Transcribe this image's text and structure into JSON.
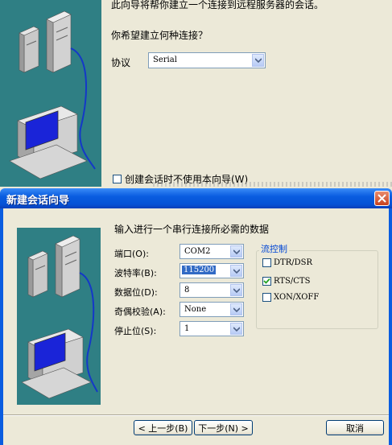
{
  "background_window": {
    "intro_text": "此向导将帮你建立一个连接到远程服务器的会话。",
    "question_text": "你希望建立何种连接？",
    "protocol_label": "协议",
    "protocol_value": "Serial",
    "no_wizard_checkbox_label": "创建会话时不使用本向导(W)",
    "no_wizard_checked": false
  },
  "dialog": {
    "title": "新建会话向导",
    "heading": "输入进行一个串行连接所必需的数据",
    "fields": {
      "port": {
        "label": "端口(O):",
        "value": "COM2"
      },
      "baud": {
        "label": "波特率(B):",
        "value": "115200"
      },
      "data_bits": {
        "label": "数据位(D):",
        "value": "8"
      },
      "parity": {
        "label": "奇偶校验(A):",
        "value": "None"
      },
      "stop_bits": {
        "label": "停止位(S):",
        "value": "1"
      }
    },
    "flow_control": {
      "title": "流控制",
      "options": [
        {
          "label": "DTR/DSR",
          "checked": false
        },
        {
          "label": "RTS/CTS",
          "checked": true
        },
        {
          "label": "XON/XOFF",
          "checked": false
        }
      ]
    },
    "buttons": {
      "back": "< 上一步(B)",
      "next": "下一步(N) >",
      "cancel": "取消"
    }
  },
  "colors": {
    "titlebar": "#0a5de0",
    "art_background": "#2f7f84",
    "group_title": "#0046d5",
    "selection": "#316ac5"
  }
}
